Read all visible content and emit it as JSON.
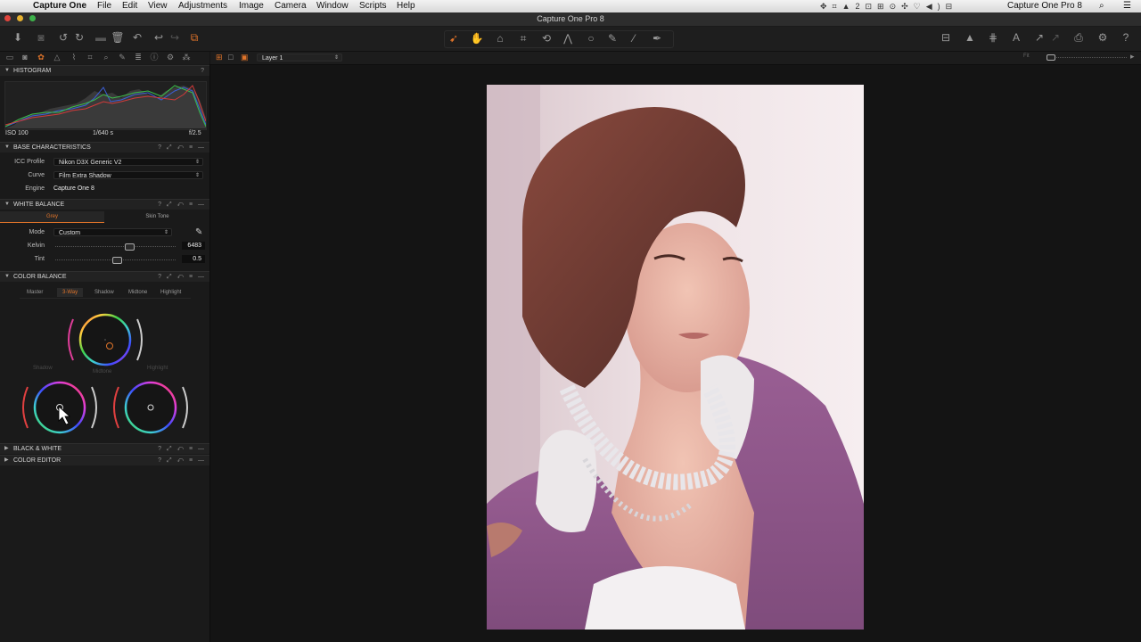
{
  "menubar": {
    "app_name": "Capture One",
    "items": [
      "File",
      "Edit",
      "View",
      "Adjustments",
      "Image",
      "Camera",
      "Window",
      "Scripts",
      "Help"
    ],
    "right_app": "Capture One Pro 8"
  },
  "window": {
    "title": "Capture One Pro 8"
  },
  "viewer": {
    "layer": "Layer 1",
    "fit_label": "Fit"
  },
  "histogram": {
    "title": "HISTOGRAM",
    "iso": "ISO 100",
    "shutter": "1/640 s",
    "aperture": "f/2.5"
  },
  "base_characteristics": {
    "title": "BASE CHARACTERISTICS",
    "icc_label": "ICC Profile",
    "icc_value": "Nikon D3X Generic V2",
    "curve_label": "Curve",
    "curve_value": "Film Extra Shadow",
    "engine_label": "Engine",
    "engine_value": "Capture One 8"
  },
  "white_balance": {
    "title": "WHITE BALANCE",
    "tab_grey": "Grey",
    "tab_skin": "Skin Tone",
    "mode_label": "Mode",
    "mode_value": "Custom",
    "kelvin_label": "Kelvin",
    "kelvin_value": "6483",
    "kelvin_pos": 0.62,
    "tint_label": "Tint",
    "tint_value": "0.5",
    "tint_pos": 0.51
  },
  "color_balance": {
    "title": "COLOR BALANCE",
    "tabs": [
      "Master",
      "3-Way",
      "Shadow",
      "Midtone",
      "Highlight"
    ],
    "wheel_shadow": "Shadow",
    "wheel_midtone": "Midtone",
    "wheel_highlight": "Highlight"
  },
  "black_white": {
    "title": "BLACK & WHITE"
  },
  "color_editor": {
    "title": "COLOR EDITOR"
  },
  "panel_icons": "? ⤢ ↶ ≡ —",
  "colors": {
    "accent": "#e0742a",
    "panel": "#1a1a1a",
    "viewer": "#141414"
  }
}
